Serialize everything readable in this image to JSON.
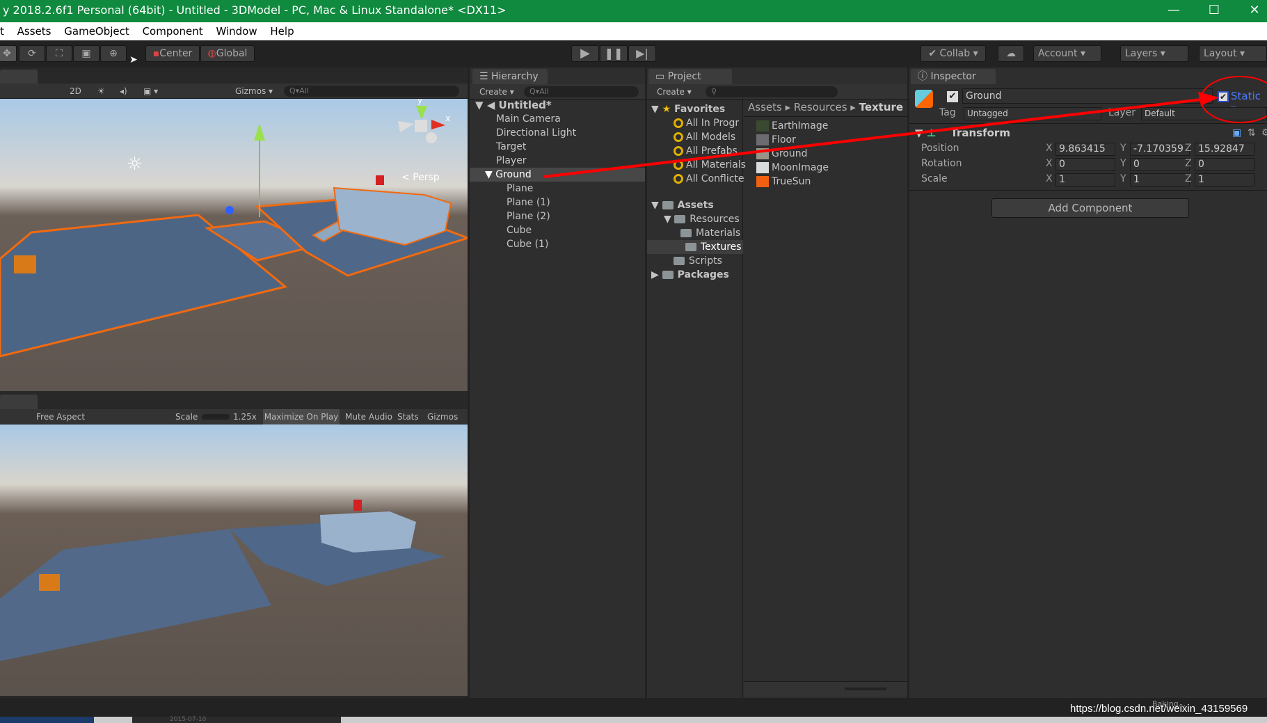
{
  "window": {
    "title": "y 2018.2.6f1 Personal (64bit) - Untitled - 3DModel - PC, Mac & Linux Standalone* <DX11>",
    "minimize": "—",
    "maximize": "☐",
    "close": "✕"
  },
  "menu": [
    "t",
    "Assets",
    "GameObject",
    "Component",
    "Window",
    "Help"
  ],
  "toolbar": {
    "pivot": "Center",
    "space": "Global",
    "collab": "Collab",
    "account": "Account",
    "layers": "Layers",
    "layout": "Layout"
  },
  "scene": {
    "mode_2d": "2D",
    "gizmos": "Gizmos",
    "search_placeholder": "All",
    "persp": "Persp",
    "axis_y": "y",
    "axis_x": "x"
  },
  "game": {
    "aspect": "Free Aspect",
    "scale_label": "Scale",
    "scale_value": "1.25x",
    "maximize": "Maximize On Play",
    "mute": "Mute Audio",
    "stats": "Stats",
    "gizmos": "Gizmos"
  },
  "hierarchy": {
    "tab": "Hierarchy",
    "create": "Create",
    "search_placeholder": "All",
    "scene": "Untitled*",
    "items": [
      {
        "label": "Main Camera",
        "indent": 1
      },
      {
        "label": "Directional Light",
        "indent": 1
      },
      {
        "label": "Target",
        "indent": 1
      },
      {
        "label": "Player",
        "indent": 1
      },
      {
        "label": "Ground",
        "indent": 1,
        "selected": true
      },
      {
        "label": "Plane",
        "indent": 2
      },
      {
        "label": "Plane (1)",
        "indent": 2
      },
      {
        "label": "Plane (2)",
        "indent": 2
      },
      {
        "label": "Cube",
        "indent": 2
      },
      {
        "label": "Cube (1)",
        "indent": 2
      }
    ]
  },
  "project": {
    "tab": "Project",
    "create": "Create",
    "favorites": {
      "label": "Favorites",
      "items": [
        "All In Progr",
        "All Models",
        "All Prefabs",
        "All Materials",
        "All Conflicte"
      ]
    },
    "assets": {
      "label": "Assets",
      "resources": "Resources",
      "materials": "Materials",
      "textures": "Textures",
      "scripts": "Scripts"
    },
    "packages": "Packages",
    "breadcrumb": [
      "Assets",
      "Resources",
      "Texture"
    ],
    "files": [
      {
        "name": "EarthImage",
        "color": "#3a4a30"
      },
      {
        "name": "Floor",
        "color": "#6c6c70"
      },
      {
        "name": "Ground",
        "color": "#9a9488"
      },
      {
        "name": "MoonImage",
        "color": "#d8dcdc"
      },
      {
        "name": "TrueSun",
        "color": "#f06010"
      }
    ]
  },
  "inspector": {
    "tab": "Inspector",
    "name": "Ground",
    "static": "Static",
    "tag_label": "Tag",
    "tag": "Untagged",
    "layer_label": "Layer",
    "layer": "Default",
    "component": "Transform",
    "rows": [
      {
        "label": "Position",
        "x": "9.863415",
        "y": "-7.170359",
        "z": "15.92847"
      },
      {
        "label": "Rotation",
        "x": "0",
        "y": "0",
        "z": "0"
      },
      {
        "label": "Scale",
        "x": "1",
        "y": "1",
        "z": "1"
      }
    ],
    "add_component": "Add Component"
  },
  "status": {
    "baking": "Baking...",
    "watermark": "https://blog.csdn.net/weixin_43159569",
    "taskbar_date": "2015-07-10"
  },
  "colors": {
    "title_green": "#0f8a3e",
    "selection_orange": "#f26a10",
    "annotation_red": "#ff0000",
    "static_blue": "#4a7bff"
  }
}
